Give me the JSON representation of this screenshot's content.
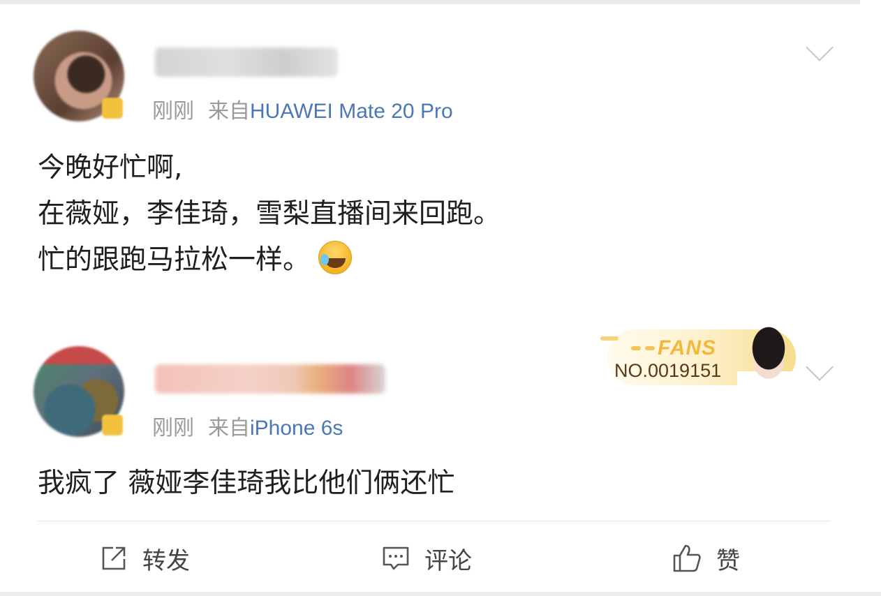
{
  "comments": [
    {
      "time": "刚刚",
      "source_prefix": "来自",
      "source": "HUAWEI Mate 20 Pro",
      "text_lines": [
        "今晚好忙啊,",
        "在薇娅，李佳琦，雪梨直播间来回跑。",
        "忙的跟跑马拉松一样。"
      ],
      "emoji": "laugh-cry-icon"
    },
    {
      "time": "刚刚",
      "source_prefix": "来自",
      "source": "iPhone 6s",
      "text": "我疯了 薇娅李佳琦我比他们俩还忙",
      "fans_badge": {
        "label": "FANS",
        "number": "NO.0019151"
      }
    }
  ],
  "actions": [
    {
      "label": "转发",
      "icon": "repost-icon"
    },
    {
      "label": "评论",
      "icon": "comment-icon"
    },
    {
      "label": "赞",
      "icon": "like-icon"
    }
  ],
  "colors": {
    "source_link": "#4a77b5",
    "meta_gray": "#9a9a9a",
    "badge_gold": "#f1b93a"
  }
}
